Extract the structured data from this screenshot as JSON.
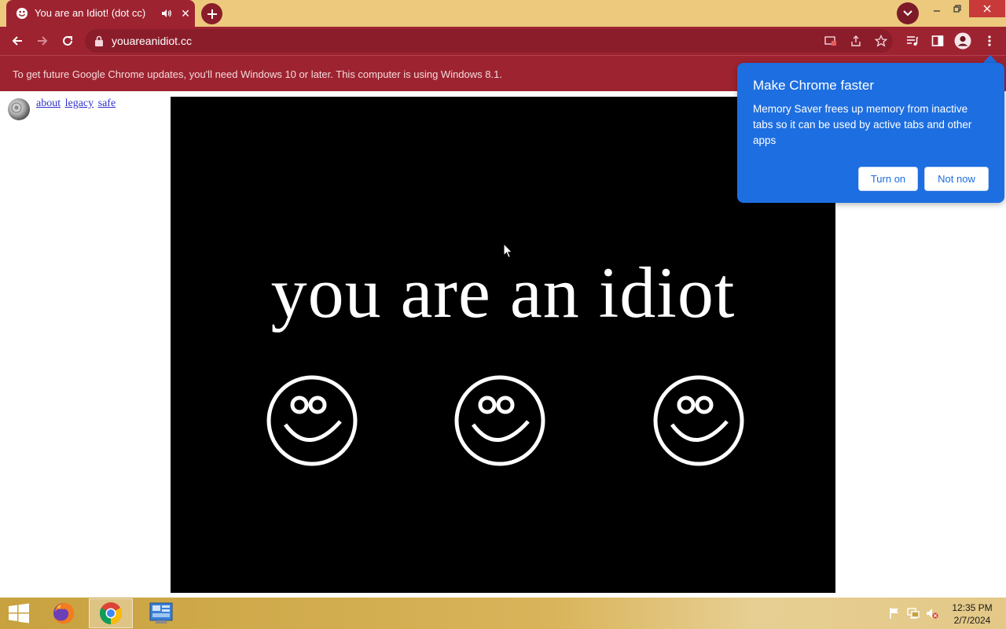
{
  "browser": {
    "tab": {
      "title": "You are an Idiot! (dot cc)",
      "close_glyph": "✕"
    },
    "url": "youareanidiot.cc",
    "theme_colors": {
      "frame": "#ecc97d",
      "toolbar": "#9e2331",
      "omnibox": "#8b1d2b"
    }
  },
  "infobar": {
    "text": "To get future Google Chrome updates, you'll need Windows 10 or later. This computer is using Windows 8.1."
  },
  "page": {
    "links": [
      "about",
      "legacy",
      "safe"
    ],
    "headline": "you are an idiot",
    "smiley_count": 3
  },
  "popup": {
    "title": "Make Chrome faster",
    "body": "Memory Saver frees up memory from inactive tabs so it can be used by active tabs and other apps",
    "primary_button": "Turn on",
    "secondary_button": "Not now",
    "color": "#1d6ee0"
  },
  "taskbar": {
    "apps": [
      "firefox-icon",
      "chrome-icon",
      "control-panel-icon"
    ],
    "clock": {
      "time": "12:35 PM",
      "date": "2/7/2024"
    }
  }
}
